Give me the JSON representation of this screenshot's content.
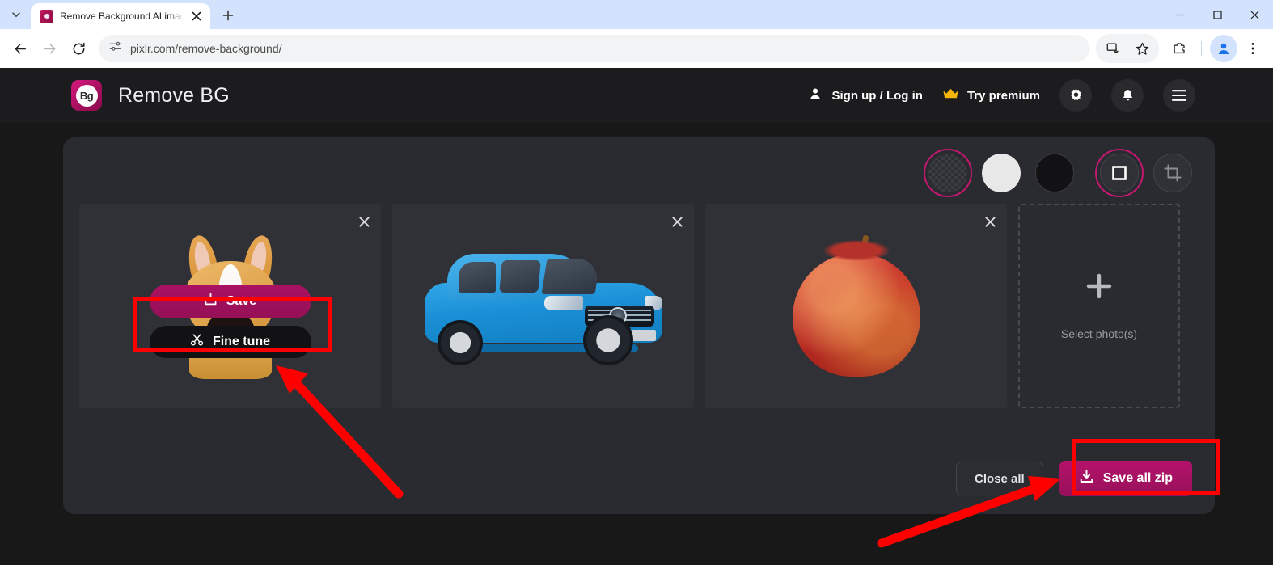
{
  "browser": {
    "tab": {
      "title": "Remove Background AI image e",
      "favicon": "pixlr-icon",
      "close": "close-tab-icon"
    },
    "new_tab": "+",
    "window": {
      "minimize": "minimize-icon",
      "maximize": "maximize-icon",
      "close": "close-window-icon"
    },
    "nav": {
      "back": "back-arrow-icon",
      "forward": "forward-arrow-icon",
      "reload": "reload-icon"
    },
    "omnibox": {
      "site_settings": "site-settings-icon",
      "url": "pixlr.com/remove-background/"
    },
    "actions": {
      "install": "install-app-icon",
      "bookmark": "bookmark-star-icon",
      "extensions": "extensions-puzzle-icon",
      "profile": "profile-avatar-icon",
      "menu": "three-dot-menu-icon"
    }
  },
  "app": {
    "logo_text": "Bg",
    "title": "Remove BG",
    "header": {
      "signup_label": "Sign up / Log in",
      "premium_label": "Try premium",
      "settings": "gear-icon",
      "notifications": "bell-icon",
      "menu": "hamburger-icon"
    },
    "background_tools": [
      {
        "name": "transparent",
        "icon": "checkerboard-swatch",
        "selected": true
      },
      {
        "name": "white",
        "icon": "white-swatch",
        "selected": false
      },
      {
        "name": "black",
        "icon": "black-swatch",
        "selected": false
      },
      {
        "name": "fit",
        "icon": "square-outline-icon",
        "selected": true
      },
      {
        "name": "crop",
        "icon": "crop-icon",
        "selected": false
      }
    ],
    "cards": [
      {
        "subject": "dog",
        "alt": "corgi dog cutout",
        "close": "close-icon",
        "has_actions": true
      },
      {
        "subject": "car",
        "alt": "blue mercedes car cutout",
        "close": "close-icon",
        "has_actions": false
      },
      {
        "subject": "apple",
        "alt": "red apple cutout",
        "close": "close-icon",
        "has_actions": false
      }
    ],
    "card_actions": {
      "save_label": "Save",
      "save_icon": "download-icon",
      "finetune_label": "Fine tune",
      "finetune_icon": "scissors-icon"
    },
    "dropzone": {
      "plus": "plus-icon",
      "label": "Select photo(s)"
    },
    "footer": {
      "close_all_label": "Close all",
      "save_all_label": "Save all zip",
      "save_all_icon": "download-icon"
    }
  },
  "annotations": {
    "accent": "#fe0000",
    "highlight_save": "red-box-around-save-button",
    "highlight_save_all": "red-box-around-save-all-zip-button",
    "arrow_finetune": "red-arrow-pointing-to-fine-tune-button",
    "arrow_save_all": "red-arrow-pointing-to-save-all-zip-button"
  },
  "colors": {
    "accent_pink": "#b5136b",
    "page_bg": "#181818",
    "panel_bg": "#2a2b30",
    "card_bg": "#303136",
    "premium_gold": "#f5b50a"
  }
}
